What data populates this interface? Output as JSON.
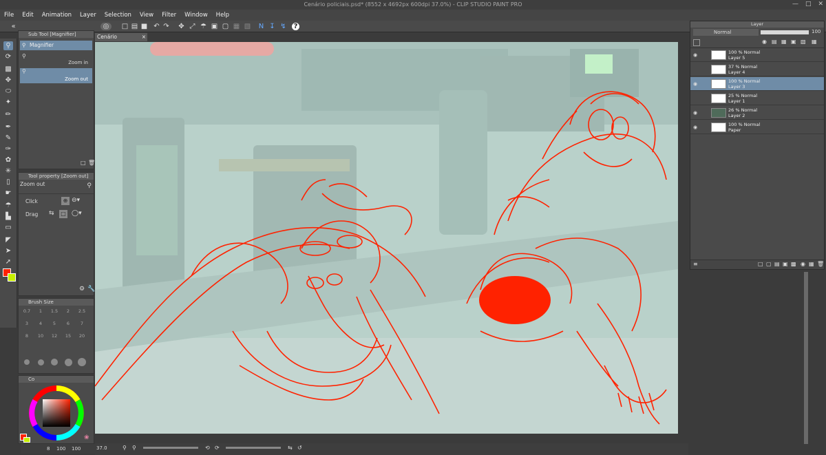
{
  "window": {
    "title": "Cenário policiais.psd* (8552 x 4692px 600dpi 37.0%)  -  CLIP STUDIO PAINT PRO"
  },
  "menu": [
    "File",
    "Edit",
    "Animation",
    "Layer",
    "Selection",
    "View",
    "Filter",
    "Window",
    "Help"
  ],
  "document_tab": {
    "label": "Cenário policiais.psd*"
  },
  "sub_tool": {
    "header": "Sub Tool [Magnifier]",
    "group": "Magnifier",
    "items": [
      "Zoom in",
      "Zoom out"
    ],
    "selected": "Zoom out"
  },
  "tool_property": {
    "header": "Tool property [Zoom out]",
    "title": "Zoom out",
    "click_label": "Click",
    "drag_label": "Drag"
  },
  "brush_size": {
    "header": "Brush Size",
    "values": [
      "0.7",
      "1",
      "1.5",
      "2",
      "2.5",
      "3",
      "4",
      "5",
      "6",
      "7",
      "8",
      "10",
      "12",
      "15",
      "20"
    ]
  },
  "color": {
    "header": "Co",
    "main_color": "#ff2200",
    "sub_color": "#c8f000",
    "status_values": [
      "8",
      "100",
      "100"
    ]
  },
  "layer_panel": {
    "header": "Layer",
    "blend_mode": "Normal",
    "opacity": "100",
    "layers": [
      {
        "info": "100 % Normal",
        "name": "Layer 5",
        "visible": true,
        "selected": false
      },
      {
        "info": "37 % Normal",
        "name": "Layer 4",
        "visible": false,
        "selected": false
      },
      {
        "info": "100 % Normal",
        "name": "Layer 3",
        "visible": true,
        "selected": true
      },
      {
        "info": "25 % Normal",
        "name": "Layer 1",
        "visible": false,
        "selected": false
      },
      {
        "info": "26 % Normal",
        "name": "Layer 2",
        "visible": true,
        "selected": false
      },
      {
        "info": "100 % Normal",
        "name": "Paper",
        "visible": true,
        "selected": false
      }
    ]
  },
  "status": {
    "zoom": "37.0"
  }
}
